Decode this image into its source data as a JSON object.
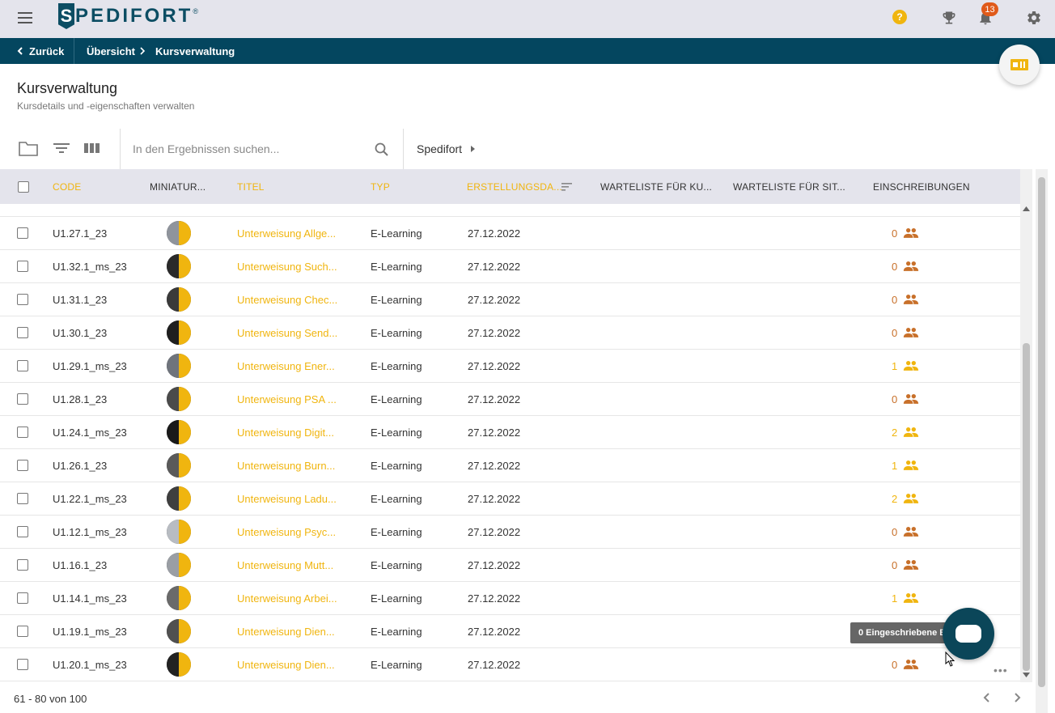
{
  "app": {
    "logo_letter": "S",
    "logo_text": "PEDIFORT",
    "logo_reg": "®",
    "notification_count": "13",
    "help_glyph": "?"
  },
  "nav": {
    "back_label": "Zurück",
    "crumbs": [
      "Übersicht",
      "Kursverwaltung"
    ]
  },
  "page": {
    "title": "Kursverwaltung",
    "subtitle": "Kursdetails und -eigenschaften verwalten"
  },
  "toolbar": {
    "search_placeholder": "In den Ergebnissen suchen...",
    "filter_label": "Spedifort"
  },
  "table": {
    "headers": {
      "code": "CODE",
      "thumbnail": "MINIATUR...",
      "title": "TITEL",
      "type": "TYP",
      "created": "ERSTELLUNGSDA...",
      "waitlist_course": "WARTELISTE FÜR KU...",
      "waitlist_session": "WARTELISTE FÜR SIT...",
      "enrollments": "EINSCHREIBUNGEN"
    },
    "rows": [
      {
        "code": "U1.27.1_23",
        "title": "Unterweisung Allge...",
        "type": "E-Learning",
        "date": "27.12.2022",
        "enrollments": "0",
        "enrolled": false
      },
      {
        "code": "U1.32.1_ms_23",
        "title": "Unterweisung Such...",
        "type": "E-Learning",
        "date": "27.12.2022",
        "enrollments": "0",
        "enrolled": false
      },
      {
        "code": "U1.31.1_23",
        "title": "Unterweisung Chec...",
        "type": "E-Learning",
        "date": "27.12.2022",
        "enrollments": "0",
        "enrolled": false
      },
      {
        "code": "U1.30.1_23",
        "title": "Unterweisung Send...",
        "type": "E-Learning",
        "date": "27.12.2022",
        "enrollments": "0",
        "enrolled": false
      },
      {
        "code": "U1.29.1_ms_23",
        "title": "Unterweisung Ener...",
        "type": "E-Learning",
        "date": "27.12.2022",
        "enrollments": "1",
        "enrolled": true
      },
      {
        "code": "U1.28.1_23",
        "title": "Unterweisung PSA ...",
        "type": "E-Learning",
        "date": "27.12.2022",
        "enrollments": "0",
        "enrolled": false
      },
      {
        "code": "U1.24.1_ms_23",
        "title": "Unterweisung Digit...",
        "type": "E-Learning",
        "date": "27.12.2022",
        "enrollments": "2",
        "enrolled": true
      },
      {
        "code": "U1.26.1_23",
        "title": "Unterweisung Burn...",
        "type": "E-Learning",
        "date": "27.12.2022",
        "enrollments": "1",
        "enrolled": true
      },
      {
        "code": "U1.22.1_ms_23",
        "title": "Unterweisung Ladu...",
        "type": "E-Learning",
        "date": "27.12.2022",
        "enrollments": "2",
        "enrolled": true
      },
      {
        "code": "U1.12.1_ms_23",
        "title": "Unterweisung Psyc...",
        "type": "E-Learning",
        "date": "27.12.2022",
        "enrollments": "0",
        "enrolled": false
      },
      {
        "code": "U1.16.1_23",
        "title": "Unterweisung Mutt...",
        "type": "E-Learning",
        "date": "27.12.2022",
        "enrollments": "0",
        "enrolled": false
      },
      {
        "code": "U1.14.1_ms_23",
        "title": "Unterweisung Arbei...",
        "type": "E-Learning",
        "date": "27.12.2022",
        "enrollments": "1",
        "enrolled": true
      },
      {
        "code": "U1.19.1_ms_23",
        "title": "Unterweisung Dien...",
        "type": "E-Learning",
        "date": "27.12.2022",
        "enrollments": "",
        "enrolled": false
      },
      {
        "code": "U1.20.1_ms_23",
        "title": "Unterweisung Dien...",
        "type": "E-Learning",
        "date": "27.12.2022",
        "enrollments": "0",
        "enrolled": false
      }
    ]
  },
  "tooltip": {
    "text": "0 Eingeschriebene B"
  },
  "footer": {
    "range": "61 - 80 von 100"
  },
  "colors": {
    "accent": "#f0b50f",
    "nav": "#04465f",
    "enroll_zero": "#c8702a"
  }
}
